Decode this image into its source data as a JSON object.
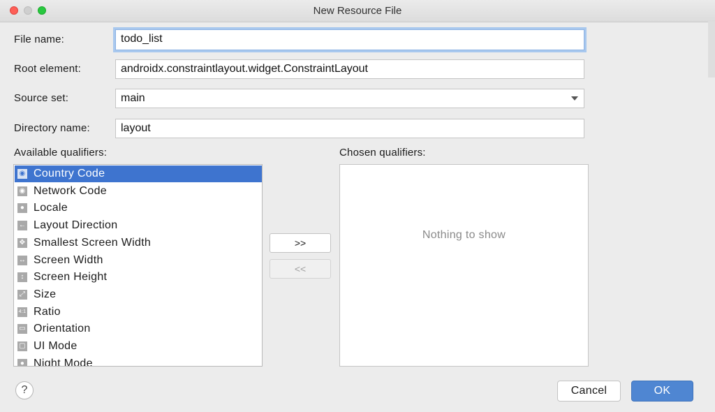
{
  "window": {
    "title": "New Resource File"
  },
  "form": {
    "file_name_label": "File name:",
    "file_name_value": "todo_list",
    "root_element_label": "Root element:",
    "root_element_value": "androidx.constraintlayout.widget.ConstraintLayout",
    "source_set_label": "Source set:",
    "source_set_value": "main",
    "directory_name_label": "Directory name:",
    "directory_name_value": "layout"
  },
  "available": {
    "label": "Available qualifiers:",
    "items": [
      {
        "label": "Country Code",
        "icon": "country-code-icon",
        "glyph": "◉",
        "selected": true
      },
      {
        "label": "Network Code",
        "icon": "network-code-icon",
        "glyph": "◉",
        "selected": false
      },
      {
        "label": "Locale",
        "icon": "globe-icon",
        "glyph": "●",
        "selected": false
      },
      {
        "label": "Layout Direction",
        "icon": "layout-direction-icon",
        "glyph": "←",
        "selected": false
      },
      {
        "label": "Smallest Screen Width",
        "icon": "smallest-width-icon",
        "glyph": "✥",
        "selected": false
      },
      {
        "label": "Screen Width",
        "icon": "screen-width-icon",
        "glyph": "↔",
        "selected": false
      },
      {
        "label": "Screen Height",
        "icon": "screen-height-icon",
        "glyph": "↕",
        "selected": false
      },
      {
        "label": "Size",
        "icon": "size-icon",
        "glyph": "⤢",
        "selected": false
      },
      {
        "label": "Ratio",
        "icon": "ratio-icon",
        "glyph": "4:1",
        "selected": false
      },
      {
        "label": "Orientation",
        "icon": "orientation-icon",
        "glyph": "▭",
        "selected": false
      },
      {
        "label": "UI Mode",
        "icon": "ui-mode-icon",
        "glyph": "▢",
        "selected": false
      },
      {
        "label": "Night Mode",
        "icon": "night-mode-icon",
        "glyph": "●",
        "selected": false
      }
    ]
  },
  "buttons": {
    "add": ">>",
    "remove": "<<",
    "cancel": "Cancel",
    "ok": "OK",
    "help": "?"
  },
  "chosen": {
    "label": "Chosen qualifiers:",
    "empty_text": "Nothing to show"
  },
  "colors": {
    "selection": "#3e74cf",
    "primary_button": "#4f86d2",
    "focus_ring": "#a8c8ee"
  }
}
